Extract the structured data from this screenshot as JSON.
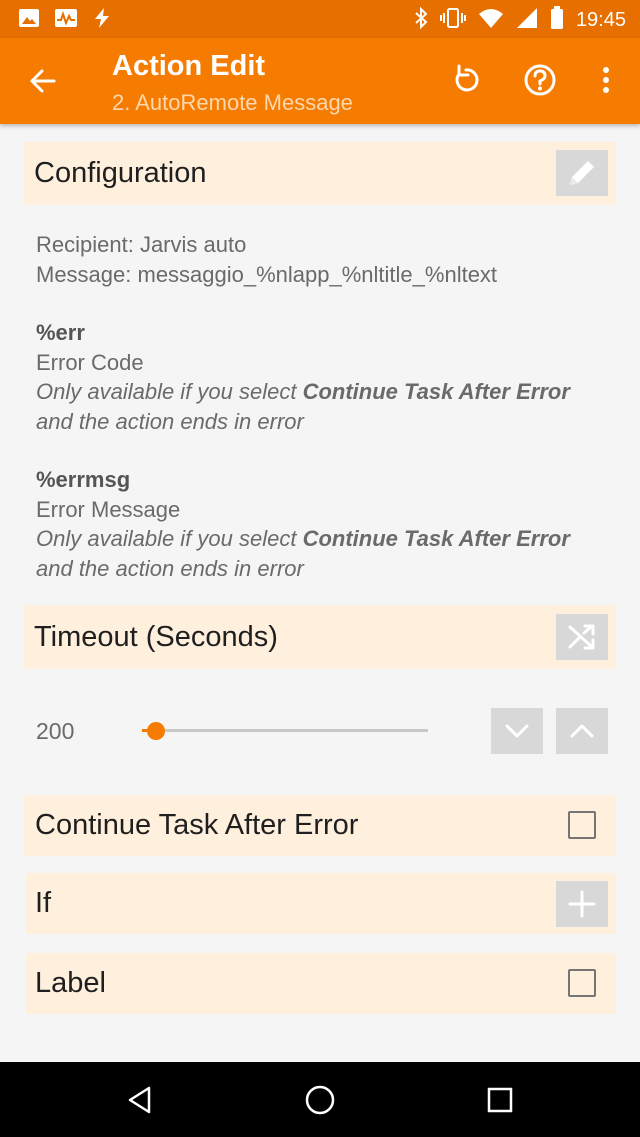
{
  "status_bar": {
    "time": "19:45",
    "left_icons": [
      "image-icon",
      "pulse-icon",
      "flash-icon"
    ],
    "right_icons": [
      "bluetooth-icon",
      "vibrate-icon",
      "wifi-icon",
      "signal-icon",
      "battery-icon"
    ]
  },
  "app_bar": {
    "title": "Action Edit",
    "subtitle": "2. AutoRemote Message",
    "color": "#f57c00",
    "status_color": "#e66f00"
  },
  "configuration": {
    "header": "Configuration",
    "recipient": "Recipient: Jarvis auto",
    "message": "Message: messaggio_%nlapp_%nltitle_%nltext"
  },
  "outputs": [
    {
      "var": "%err",
      "name": "Error Code",
      "note_prefix": "Only available if you select ",
      "note_bold": "Continue Task After Error",
      "note_suffix": "and the action ends in error"
    },
    {
      "var": "%errmsg",
      "name": "Error Message",
      "note_prefix": "Only available if you select ",
      "note_bold": "Continue Task After Error",
      "note_suffix": "and the action ends in error"
    }
  ],
  "timeout": {
    "header": "Timeout (Seconds)",
    "value": "200",
    "slider_fraction": 0.05
  },
  "continue_task": {
    "label": "Continue Task After Error",
    "checked": false
  },
  "if_section": {
    "label": "If"
  },
  "label_section": {
    "label": "Label",
    "checked": false
  }
}
